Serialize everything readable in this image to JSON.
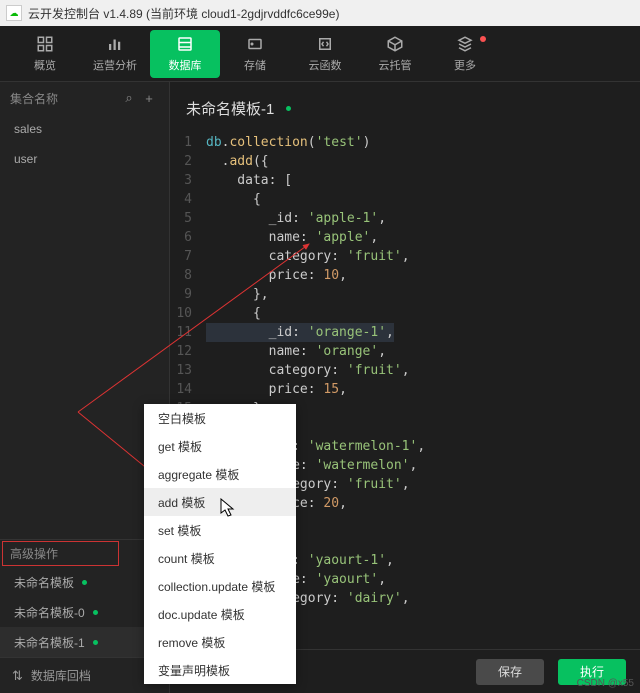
{
  "window": {
    "title": "云开发控制台 v1.4.89 (当前环境 cloud1-2gdjrvddfc6ce99e)"
  },
  "nav": {
    "items": [
      {
        "label": "概览"
      },
      {
        "label": "运营分析"
      },
      {
        "label": "数据库"
      },
      {
        "label": "存储"
      },
      {
        "label": "云函数"
      },
      {
        "label": "云托管"
      },
      {
        "label": "更多"
      }
    ]
  },
  "sidebar": {
    "header": "集合名称",
    "collections": [
      "sales",
      "user"
    ],
    "advanced_label": "高级操作",
    "templates": [
      {
        "label": "未命名模板",
        "dirty": true,
        "selected": false
      },
      {
        "label": "未命名模板-0",
        "dirty": true,
        "selected": false
      },
      {
        "label": "未命名模板-1",
        "dirty": true,
        "selected": true
      }
    ],
    "footer": "数据库回档"
  },
  "main": {
    "title": "未命名模板-1",
    "code_data": {
      "collection": "test",
      "records": [
        {
          "_id": "apple-1",
          "name": "apple",
          "category": "fruit",
          "price": 10
        },
        {
          "_id": "orange-1",
          "name": "orange",
          "category": "fruit",
          "price": 15
        },
        {
          "_id": "watermelon-1",
          "name": "watermelon",
          "category": "fruit",
          "price": 20
        },
        {
          "_id": "yaourt-1",
          "name": "yaourt",
          "category": "dairy"
        }
      ]
    }
  },
  "context_menu": {
    "items": [
      "空白模板",
      "get 模板",
      "aggregate 模板",
      "add 模板",
      "set 模板",
      "count 模板",
      "collection.update 模板",
      "doc.update 模板",
      "remove 模板",
      "变量声明模板"
    ],
    "hover_index": 3
  },
  "footer": {
    "save": "保存",
    "run": "执行"
  },
  "watermark": "CSDN @x55"
}
